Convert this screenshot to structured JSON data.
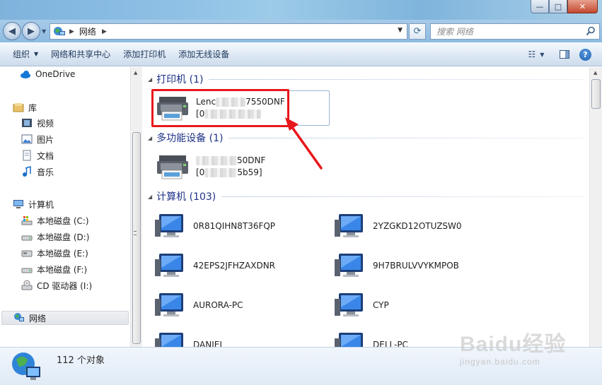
{
  "window": {
    "min": "—",
    "max": "□",
    "close": "✕"
  },
  "address": {
    "crumb": "网络",
    "search_placeholder": "搜索 网络"
  },
  "toolbar": {
    "organize": "组织",
    "network_sharing_center": "网络和共享中心",
    "add_printer": "添加打印机",
    "add_wireless_device": "添加无线设备"
  },
  "nav": {
    "onedrive": "OneDrive",
    "library": "库",
    "videos": "视频",
    "pictures": "图片",
    "documents": "文档",
    "music": "音乐",
    "computer": "计算机",
    "drive_c": "本地磁盘 (C:)",
    "drive_d": "本地磁盘 (D:)",
    "drive_e": "本地磁盘 (E:)",
    "drive_f": "本地磁盘 (F:)",
    "drive_i": "CD 驱动器 (I:)",
    "network": "网络"
  },
  "groups": {
    "printers": "打印机 (1)",
    "multifunction": "多功能设备 (1)",
    "computers": "计算机 (103)"
  },
  "devices": {
    "printer_name_a": "Lenc",
    "printer_name_b": "7550DNF",
    "printer_sub": "[0",
    "mfd_name": "50DNF",
    "mfd_sub_a": "[0",
    "mfd_sub_b": "5b59]"
  },
  "computers": [
    "0R81QIHN8T36FQP",
    "2YZGKD12OTUZSW0",
    "42EPS2JFHZAXDNR",
    "9H7BRULVVYKMPOB",
    "AURORA-PC",
    "CYP",
    "DANIEL",
    "DELL-PC"
  ],
  "status": {
    "count": "112 个对象"
  },
  "watermark": {
    "brand": "Baidu经验",
    "url": "jingyan.baidu.com"
  },
  "colors": {
    "annotation": "#e8171b",
    "group_title": "#1e3287"
  }
}
